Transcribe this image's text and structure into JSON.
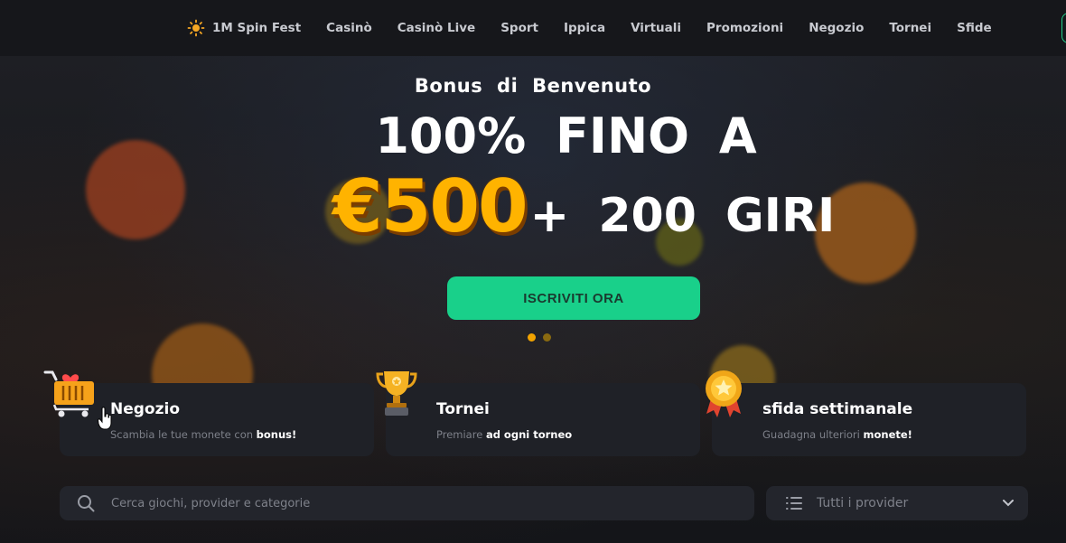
{
  "nav": {
    "items": [
      {
        "label": "1M Spin Fest",
        "icon": "sun-icon"
      },
      {
        "label": "Casinò"
      },
      {
        "label": "Casinò Live"
      },
      {
        "label": "Sport"
      },
      {
        "label": "Ippica"
      },
      {
        "label": "Virtuali"
      },
      {
        "label": "Promozioni"
      },
      {
        "label": "Negozio"
      },
      {
        "label": "Tornei"
      },
      {
        "label": "Sfide"
      }
    ]
  },
  "hero": {
    "subtitle": "Bonus di Benvenuto",
    "line1": "100% FINO A",
    "amount": "€500",
    "spins": "+ 200 GIRI",
    "cta_label": "ISCRIVITI ORA",
    "slides_total": 2,
    "active_slide": 1
  },
  "cards": [
    {
      "title": "Negozio",
      "desc_plain": "Scambia le tue monete con ",
      "desc_bold": "bonus!",
      "icon": "shopping-cart-icon"
    },
    {
      "title": "Tornei",
      "desc_plain": "Premiare ",
      "desc_bold": "ad ogni torneo",
      "icon": "trophy-icon"
    },
    {
      "title": "sfida settimanale",
      "desc_plain": "Guadagna ulteriori ",
      "desc_bold": "monete!",
      "icon": "medal-icon"
    }
  ],
  "search": {
    "placeholder": "Cerca giochi, provider e categorie",
    "icon": "search-icon"
  },
  "provider_filter": {
    "label": "Tutti i provider",
    "icon": "list-icon"
  },
  "colors": {
    "accent_green": "#19d08a",
    "amount_orange": "#ffb300",
    "background": "#16171c"
  }
}
